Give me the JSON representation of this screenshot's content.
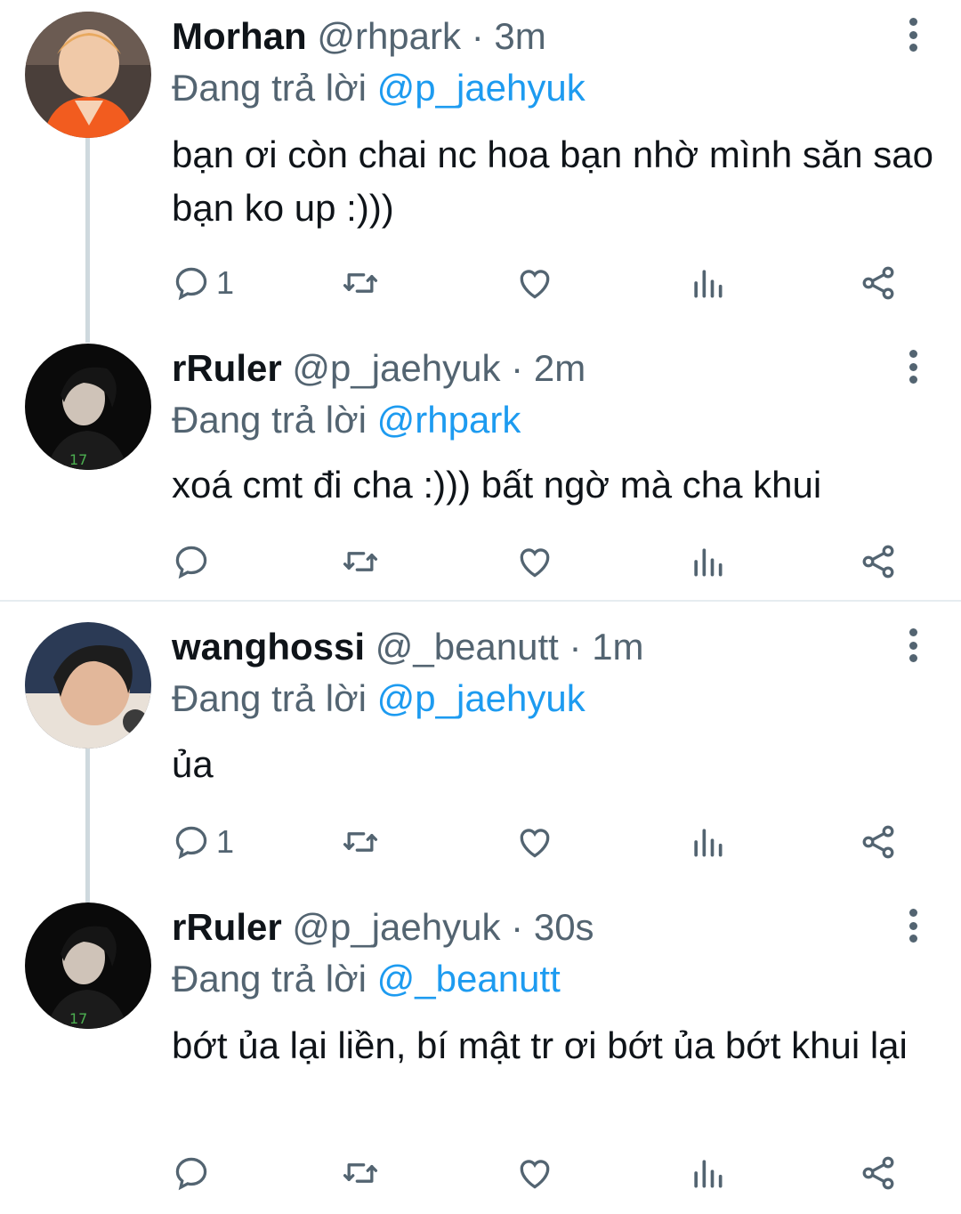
{
  "tweets": [
    {
      "name": "Morhan",
      "handle": "@rhpark",
      "time": "3m",
      "reply_prefix": "Đang trả lời",
      "reply_to": "@p_jaehyuk",
      "text": "bạn ơi còn chai nc hoa bạn nhờ mình săn sao bạn ko up :)))",
      "reply_count": "1"
    },
    {
      "name": "rRuler",
      "handle": "@p_jaehyuk",
      "time": "2m",
      "reply_prefix": "Đang trả lời",
      "reply_to": "@rhpark",
      "text": "xoá cmt đi cha :))) bất ngờ mà cha khui",
      "reply_count": ""
    },
    {
      "name": "wanghossi",
      "handle": "@_beanutt",
      "time": "1m",
      "reply_prefix": "Đang trả lời",
      "reply_to": "@p_jaehyuk",
      "text": "ủa",
      "reply_count": "1"
    },
    {
      "name": "rRuler",
      "handle": "@p_jaehyuk",
      "time": "30s",
      "reply_prefix": "Đang trả lời",
      "reply_to": "@_beanutt",
      "text": "bớt ủa lại liền, bí mật tr ơi bớt ủa bớt khui lại",
      "reply_count": ""
    }
  ],
  "separator": "·",
  "icons": [
    "reply-icon",
    "retweet-icon",
    "like-icon",
    "analytics-icon",
    "share-icon",
    "more-options-icon"
  ],
  "colors": {
    "mention": "#1d9bf0",
    "muted": "#536471",
    "thread_line": "#cfd9de"
  }
}
